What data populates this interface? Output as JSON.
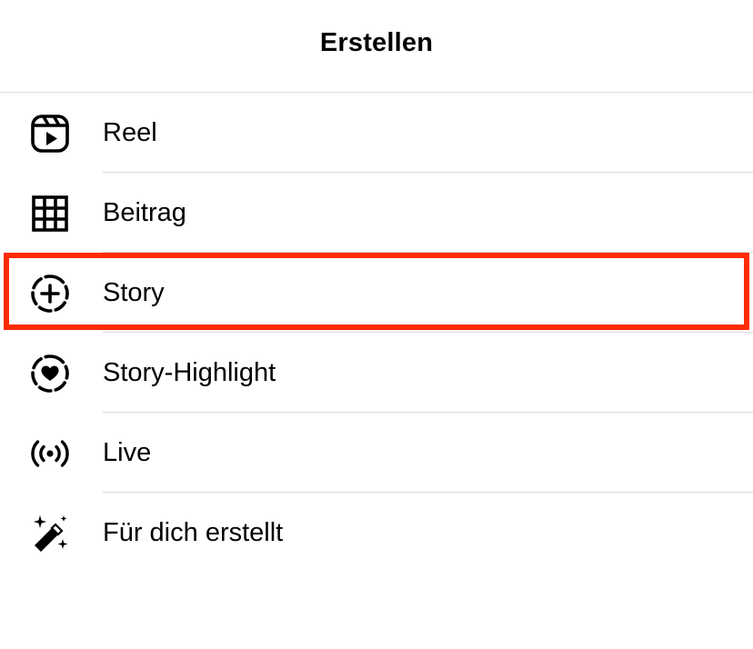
{
  "header": {
    "title": "Erstellen"
  },
  "menu": {
    "items": [
      {
        "label": "Reel",
        "icon": "reel-icon"
      },
      {
        "label": "Beitrag",
        "icon": "grid-icon"
      },
      {
        "label": "Story",
        "icon": "story-add-icon"
      },
      {
        "label": "Story-Highlight",
        "icon": "story-highlight-heart-icon"
      },
      {
        "label": "Live",
        "icon": "live-broadcast-icon"
      },
      {
        "label": "Für dich erstellt",
        "icon": "magic-wand-icon"
      }
    ]
  },
  "highlight": {
    "target": "Story",
    "color": "#ff2b06"
  },
  "colors": {
    "separator": "#dbdbdb",
    "text": "#000000",
    "background": "#ffffff"
  }
}
